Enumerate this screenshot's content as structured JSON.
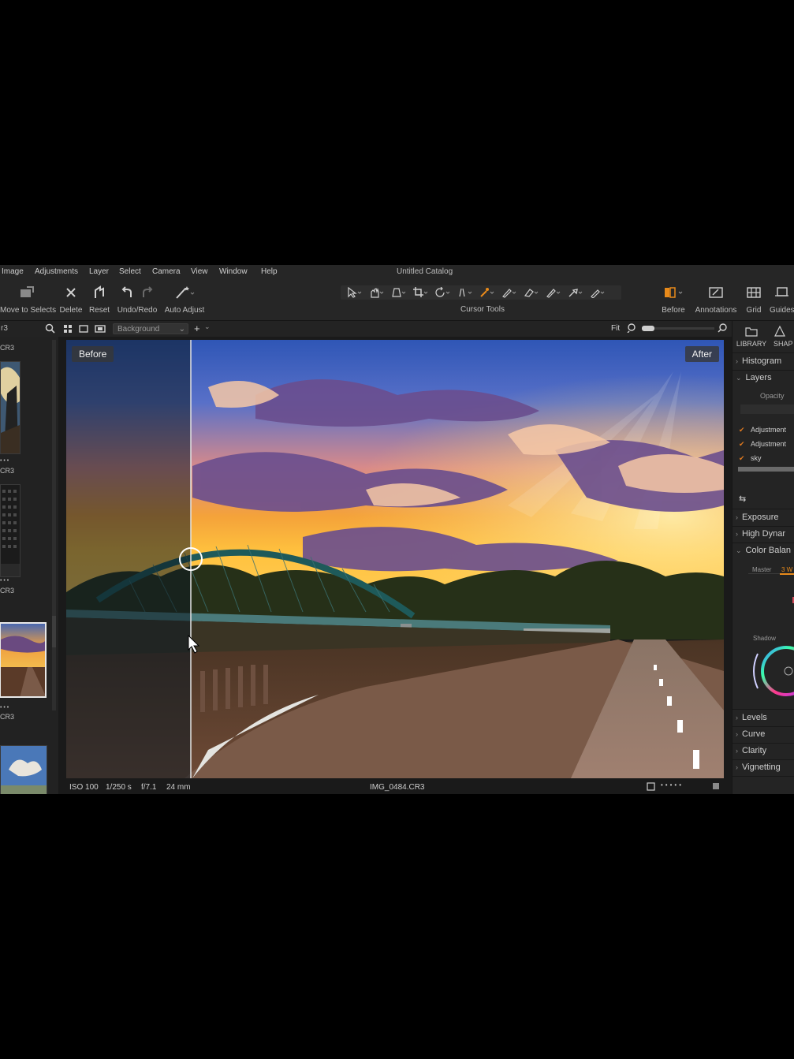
{
  "menu": {
    "items": [
      "Image",
      "Adjustments",
      "Layer",
      "Select",
      "Camera",
      "View",
      "Window",
      "Help"
    ],
    "catalog_title": "Untitled Catalog"
  },
  "toolbar": {
    "move_to_selects": "Move to Selects",
    "delete": "Delete",
    "reset": "Reset",
    "undo_redo": "Undo/Redo",
    "auto_adjust": "Auto Adjust",
    "cursor_tools": "Cursor Tools",
    "before": "Before",
    "annotations": "Annotations",
    "grid": "Grid",
    "guides": "Guides"
  },
  "subbar": {
    "left_label": "r3",
    "layer_select": "Background",
    "fit": "Fit"
  },
  "filmstrip": {
    "labels": [
      "CR3",
      "CR3",
      "CR3",
      "CR3"
    ]
  },
  "viewer": {
    "before_tag": "Before",
    "after_tag": "After",
    "iso": "ISO 100",
    "shutter": "1/250 s",
    "aperture": "f/7.1",
    "focal": "24 mm",
    "filename": "IMG_0484.CR3",
    "split_fraction": 0.19
  },
  "right_panel": {
    "tabs": {
      "library": "LIBRARY",
      "shape": "SHAP"
    },
    "histogram": "Histogram",
    "layers": "Layers",
    "opacity": "Opacity",
    "layer_items": [
      "Adjustment",
      "Adjustment",
      "sky"
    ],
    "exposure": "Exposure",
    "high_dynamic": "High Dynar",
    "color_balance": "Color Balan",
    "master": "Master",
    "three_way": "3 W",
    "shadow": "Shadow",
    "levels": "Levels",
    "curve": "Curve",
    "clarity": "Clarity",
    "vignetting": "Vignetting"
  },
  "colors": {
    "accent": "#e88a1a",
    "panel": "#242424",
    "background": "#1f1f1f"
  }
}
